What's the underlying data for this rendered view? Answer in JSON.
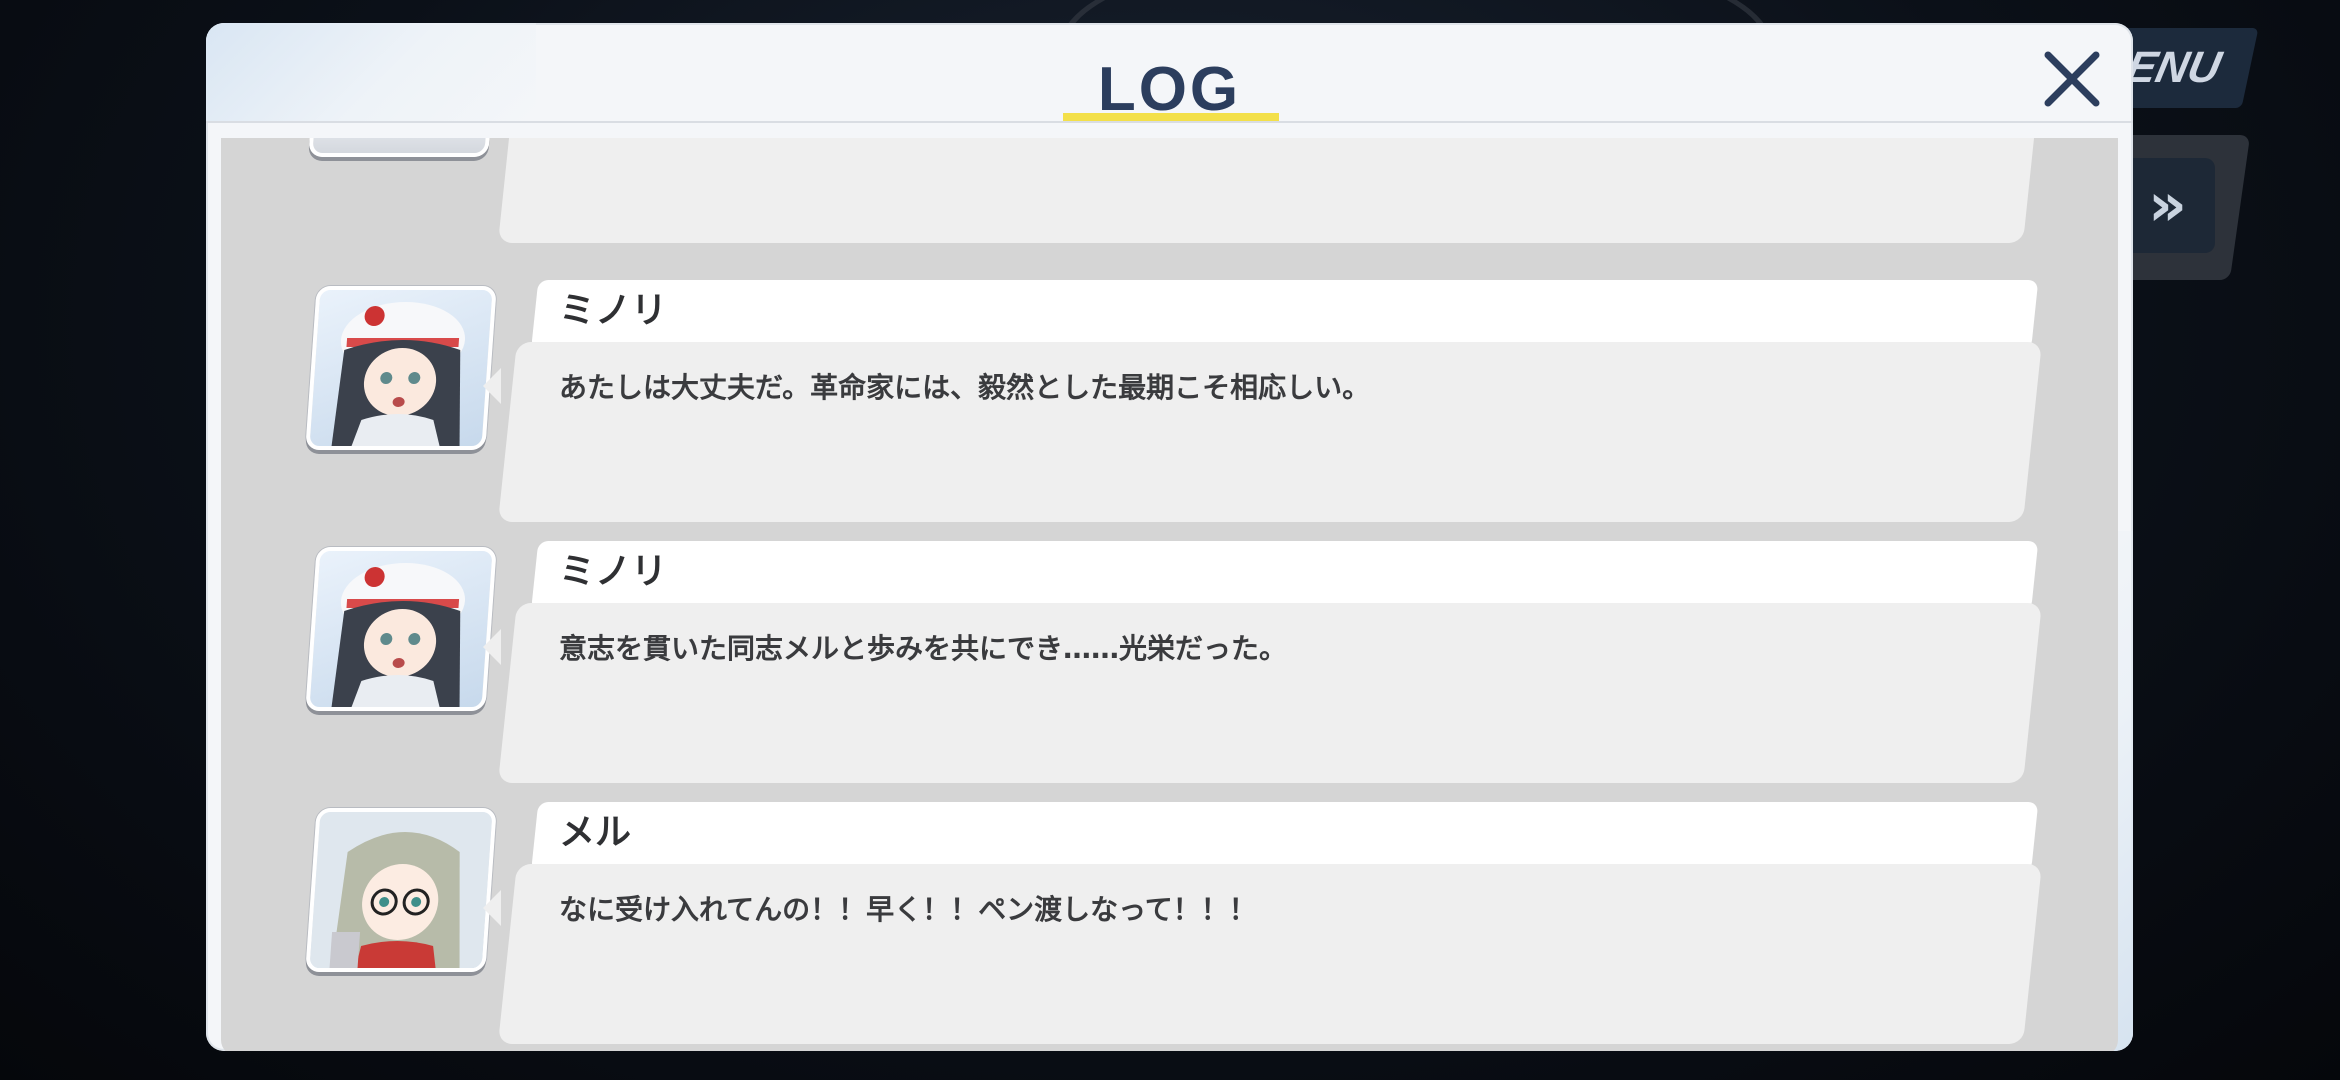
{
  "background": {
    "menu_label": "ENU",
    "skip_icon": "double-chevron-right-icon"
  },
  "log": {
    "title": "LOG",
    "close_icon": "close-icon",
    "accent_color": "#f3e04a",
    "entries": [
      {
        "speaker": "ミノリ",
        "text": "あたしは大丈夫だ。革命家には、毅然とした最期こそ相応しい。",
        "avatar": "minori-avatar"
      },
      {
        "speaker": "ミノリ",
        "text": "意志を貫いた同志メルと歩みを共にでき……光栄だった。",
        "avatar": "minori-avatar"
      },
      {
        "speaker": "メル",
        "text": "なに受け入れてんの！！早く！！ペン渡しなって！！！",
        "avatar": "meru-avatar"
      }
    ]
  }
}
